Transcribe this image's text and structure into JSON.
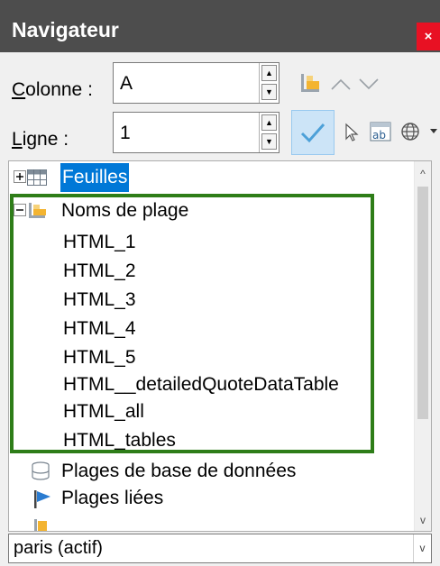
{
  "window": {
    "title": "Navigateur",
    "close_glyph": "×"
  },
  "fields": {
    "column": {
      "label_accel": "C",
      "label_rest": "olonne :",
      "value": "A"
    },
    "row": {
      "label_accel": "L",
      "label_rest": "igne :",
      "value": "1"
    }
  },
  "spin_glyphs": {
    "up": "▲",
    "down": "▼"
  },
  "toolbar": {
    "row1": [
      "data-range-icon",
      "chevron-up-icon",
      "chevron-down-icon"
    ],
    "row2": [
      "check-icon",
      "pointer-icon",
      "drag-mode-icon",
      "globe-icon",
      "dropdown-arrow-icon"
    ]
  },
  "tree": {
    "sheets": {
      "expander": "+",
      "label": "Feuilles"
    },
    "range_names": {
      "expander": "−",
      "label": "Noms de plage",
      "children": [
        "HTML_1",
        "HTML_2",
        "HTML_3",
        "HTML_4",
        "HTML_5",
        "HTML__detailedQuoteDataTable",
        "HTML_all",
        "HTML_tables"
      ]
    },
    "database_ranges": {
      "label": "Plages de base de données"
    },
    "linked_ranges": {
      "label": "Plages liées"
    }
  },
  "scrollbar": {
    "up_glyph": "^",
    "down_glyph": "v"
  },
  "document_combo": {
    "value": "paris (actif)",
    "arrow": "v"
  },
  "colors": {
    "titlebar": "#4d4d4d",
    "selection": "#0078d7",
    "highlight_border": "#2e7d18",
    "close": "#e81123",
    "check": "#4ca0d8"
  }
}
